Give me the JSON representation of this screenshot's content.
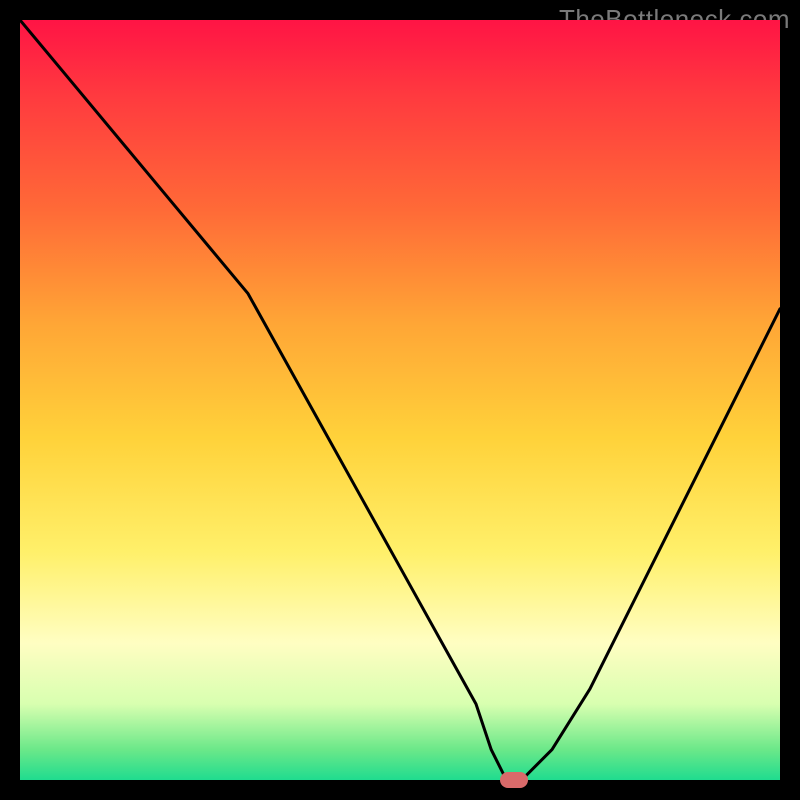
{
  "watermark": "TheBottleneck.com",
  "colors": {
    "curve": "#000000",
    "marker": "#d96a6a",
    "background_black": "#000000"
  },
  "chart_data": {
    "type": "line",
    "title": "",
    "xlabel": "",
    "ylabel": "",
    "xlim": [
      0,
      100
    ],
    "ylim": [
      0,
      100
    ],
    "grid": false,
    "legend": false,
    "series": [
      {
        "name": "bottleneck-curve",
        "x": [
          0,
          5,
          10,
          15,
          20,
          25,
          30,
          35,
          40,
          45,
          50,
          55,
          60,
          62,
          64,
          66,
          70,
          75,
          80,
          85,
          90,
          95,
          100
        ],
        "y": [
          100,
          94,
          88,
          82,
          76,
          70,
          64,
          55,
          46,
          37,
          28,
          19,
          10,
          4,
          0,
          0,
          4,
          12,
          22,
          32,
          42,
          52,
          62
        ]
      }
    ],
    "marker": {
      "x": 65,
      "y": 0
    },
    "gradient_stops": [
      {
        "pos": 0.0,
        "color": "#ff1445"
      },
      {
        "pos": 0.25,
        "color": "#ff6a37"
      },
      {
        "pos": 0.55,
        "color": "#ffd23a"
      },
      {
        "pos": 0.82,
        "color": "#fffec2"
      },
      {
        "pos": 1.0,
        "color": "#1fdc8f"
      }
    ]
  }
}
